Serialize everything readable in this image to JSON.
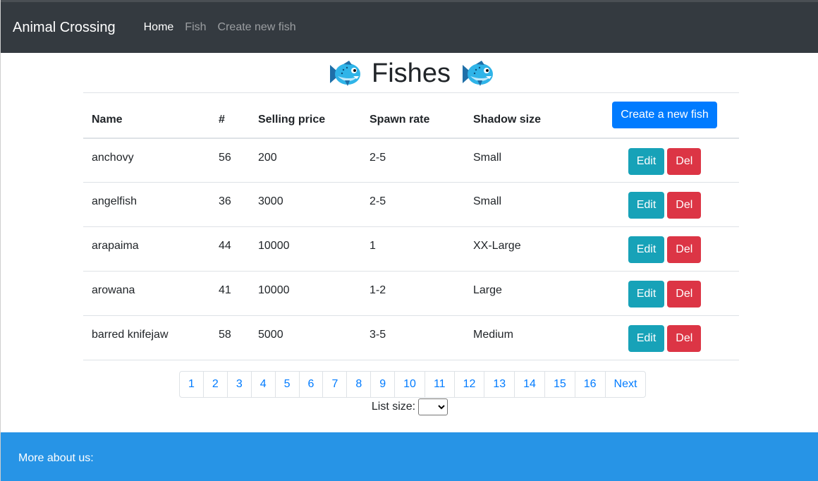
{
  "navbar": {
    "brand": "Animal Crossing",
    "links": [
      "Home",
      "Fish",
      "Create new fish"
    ]
  },
  "page": {
    "title": "Fishes",
    "left_icon": "fish-icon",
    "right_icon": "fish-icon"
  },
  "table": {
    "headers": [
      "Name",
      "#",
      "Selling price",
      "Spawn rate",
      "Shadow size"
    ],
    "create_button": "Create a new fish",
    "edit_label": "Edit",
    "delete_label": "Del",
    "rows": [
      {
        "name": "anchovy",
        "num": "56",
        "price": "200",
        "spawn": "2-5",
        "shadow": "Small"
      },
      {
        "name": "angelfish",
        "num": "36",
        "price": "3000",
        "spawn": "2-5",
        "shadow": "Small"
      },
      {
        "name": "arapaima",
        "num": "44",
        "price": "10000",
        "spawn": "1",
        "shadow": "XX-Large"
      },
      {
        "name": "arowana",
        "num": "41",
        "price": "10000",
        "spawn": "1-2",
        "shadow": "Large"
      },
      {
        "name": "barred knifejaw",
        "num": "58",
        "price": "5000",
        "spawn": "3-5",
        "shadow": "Medium"
      }
    ]
  },
  "pagination": {
    "pages": [
      "1",
      "2",
      "3",
      "4",
      "5",
      "6",
      "7",
      "8",
      "9",
      "10",
      "11",
      "12",
      "13",
      "14",
      "15",
      "16"
    ],
    "next": "Next"
  },
  "list_size": {
    "label": "List size:",
    "value": ""
  },
  "footer": {
    "text": "More about us:"
  },
  "colors": {
    "navbar": "#343a40",
    "primary": "#007bff",
    "info": "#17a2b8",
    "danger": "#dc3545",
    "footer": "#2794e6"
  }
}
